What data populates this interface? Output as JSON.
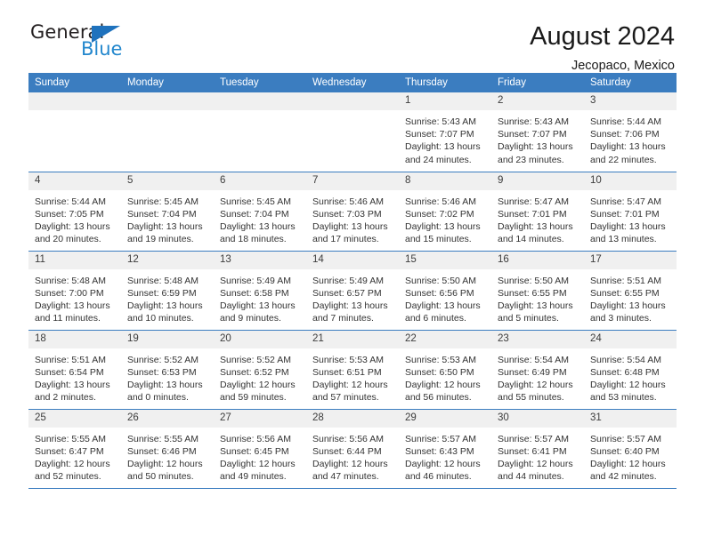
{
  "logo": {
    "word_top": "General",
    "word_bottom": "Blue",
    "triangle_color": "#1f72bd",
    "text_color": "#231f20",
    "blue_color": "#2387cd"
  },
  "header": {
    "title": "August 2024",
    "subtitle": "Jecopaco, Mexico"
  },
  "theme": {
    "header_blue": "#3b7dc0",
    "daynum_band": "#f0f0f0",
    "text": "#333333"
  },
  "weekdays": [
    "Sunday",
    "Monday",
    "Tuesday",
    "Wednesday",
    "Thursday",
    "Friday",
    "Saturday"
  ],
  "labels": {
    "sunrise_prefix": "Sunrise:",
    "sunset_prefix": "Sunset:",
    "daylight_prefix": "Daylight:"
  },
  "weeks": [
    [
      {
        "day": "",
        "sunrise": "",
        "sunset": "",
        "daylight": ""
      },
      {
        "day": "",
        "sunrise": "",
        "sunset": "",
        "daylight": ""
      },
      {
        "day": "",
        "sunrise": "",
        "sunset": "",
        "daylight": ""
      },
      {
        "day": "",
        "sunrise": "",
        "sunset": "",
        "daylight": ""
      },
      {
        "day": "1",
        "sunrise": "Sunrise: 5:43 AM",
        "sunset": "Sunset: 7:07 PM",
        "daylight": "Daylight: 13 hours and 24 minutes."
      },
      {
        "day": "2",
        "sunrise": "Sunrise: 5:43 AM",
        "sunset": "Sunset: 7:07 PM",
        "daylight": "Daylight: 13 hours and 23 minutes."
      },
      {
        "day": "3",
        "sunrise": "Sunrise: 5:44 AM",
        "sunset": "Sunset: 7:06 PM",
        "daylight": "Daylight: 13 hours and 22 minutes."
      }
    ],
    [
      {
        "day": "4",
        "sunrise": "Sunrise: 5:44 AM",
        "sunset": "Sunset: 7:05 PM",
        "daylight": "Daylight: 13 hours and 20 minutes."
      },
      {
        "day": "5",
        "sunrise": "Sunrise: 5:45 AM",
        "sunset": "Sunset: 7:04 PM",
        "daylight": "Daylight: 13 hours and 19 minutes."
      },
      {
        "day": "6",
        "sunrise": "Sunrise: 5:45 AM",
        "sunset": "Sunset: 7:04 PM",
        "daylight": "Daylight: 13 hours and 18 minutes."
      },
      {
        "day": "7",
        "sunrise": "Sunrise: 5:46 AM",
        "sunset": "Sunset: 7:03 PM",
        "daylight": "Daylight: 13 hours and 17 minutes."
      },
      {
        "day": "8",
        "sunrise": "Sunrise: 5:46 AM",
        "sunset": "Sunset: 7:02 PM",
        "daylight": "Daylight: 13 hours and 15 minutes."
      },
      {
        "day": "9",
        "sunrise": "Sunrise: 5:47 AM",
        "sunset": "Sunset: 7:01 PM",
        "daylight": "Daylight: 13 hours and 14 minutes."
      },
      {
        "day": "10",
        "sunrise": "Sunrise: 5:47 AM",
        "sunset": "Sunset: 7:01 PM",
        "daylight": "Daylight: 13 hours and 13 minutes."
      }
    ],
    [
      {
        "day": "11",
        "sunrise": "Sunrise: 5:48 AM",
        "sunset": "Sunset: 7:00 PM",
        "daylight": "Daylight: 13 hours and 11 minutes."
      },
      {
        "day": "12",
        "sunrise": "Sunrise: 5:48 AM",
        "sunset": "Sunset: 6:59 PM",
        "daylight": "Daylight: 13 hours and 10 minutes."
      },
      {
        "day": "13",
        "sunrise": "Sunrise: 5:49 AM",
        "sunset": "Sunset: 6:58 PM",
        "daylight": "Daylight: 13 hours and 9 minutes."
      },
      {
        "day": "14",
        "sunrise": "Sunrise: 5:49 AM",
        "sunset": "Sunset: 6:57 PM",
        "daylight": "Daylight: 13 hours and 7 minutes."
      },
      {
        "day": "15",
        "sunrise": "Sunrise: 5:50 AM",
        "sunset": "Sunset: 6:56 PM",
        "daylight": "Daylight: 13 hours and 6 minutes."
      },
      {
        "day": "16",
        "sunrise": "Sunrise: 5:50 AM",
        "sunset": "Sunset: 6:55 PM",
        "daylight": "Daylight: 13 hours and 5 minutes."
      },
      {
        "day": "17",
        "sunrise": "Sunrise: 5:51 AM",
        "sunset": "Sunset: 6:55 PM",
        "daylight": "Daylight: 13 hours and 3 minutes."
      }
    ],
    [
      {
        "day": "18",
        "sunrise": "Sunrise: 5:51 AM",
        "sunset": "Sunset: 6:54 PM",
        "daylight": "Daylight: 13 hours and 2 minutes."
      },
      {
        "day": "19",
        "sunrise": "Sunrise: 5:52 AM",
        "sunset": "Sunset: 6:53 PM",
        "daylight": "Daylight: 13 hours and 0 minutes."
      },
      {
        "day": "20",
        "sunrise": "Sunrise: 5:52 AM",
        "sunset": "Sunset: 6:52 PM",
        "daylight": "Daylight: 12 hours and 59 minutes."
      },
      {
        "day": "21",
        "sunrise": "Sunrise: 5:53 AM",
        "sunset": "Sunset: 6:51 PM",
        "daylight": "Daylight: 12 hours and 57 minutes."
      },
      {
        "day": "22",
        "sunrise": "Sunrise: 5:53 AM",
        "sunset": "Sunset: 6:50 PM",
        "daylight": "Daylight: 12 hours and 56 minutes."
      },
      {
        "day": "23",
        "sunrise": "Sunrise: 5:54 AM",
        "sunset": "Sunset: 6:49 PM",
        "daylight": "Daylight: 12 hours and 55 minutes."
      },
      {
        "day": "24",
        "sunrise": "Sunrise: 5:54 AM",
        "sunset": "Sunset: 6:48 PM",
        "daylight": "Daylight: 12 hours and 53 minutes."
      }
    ],
    [
      {
        "day": "25",
        "sunrise": "Sunrise: 5:55 AM",
        "sunset": "Sunset: 6:47 PM",
        "daylight": "Daylight: 12 hours and 52 minutes."
      },
      {
        "day": "26",
        "sunrise": "Sunrise: 5:55 AM",
        "sunset": "Sunset: 6:46 PM",
        "daylight": "Daylight: 12 hours and 50 minutes."
      },
      {
        "day": "27",
        "sunrise": "Sunrise: 5:56 AM",
        "sunset": "Sunset: 6:45 PM",
        "daylight": "Daylight: 12 hours and 49 minutes."
      },
      {
        "day": "28",
        "sunrise": "Sunrise: 5:56 AM",
        "sunset": "Sunset: 6:44 PM",
        "daylight": "Daylight: 12 hours and 47 minutes."
      },
      {
        "day": "29",
        "sunrise": "Sunrise: 5:57 AM",
        "sunset": "Sunset: 6:43 PM",
        "daylight": "Daylight: 12 hours and 46 minutes."
      },
      {
        "day": "30",
        "sunrise": "Sunrise: 5:57 AM",
        "sunset": "Sunset: 6:41 PM",
        "daylight": "Daylight: 12 hours and 44 minutes."
      },
      {
        "day": "31",
        "sunrise": "Sunrise: 5:57 AM",
        "sunset": "Sunset: 6:40 PM",
        "daylight": "Daylight: 12 hours and 42 minutes."
      }
    ]
  ]
}
